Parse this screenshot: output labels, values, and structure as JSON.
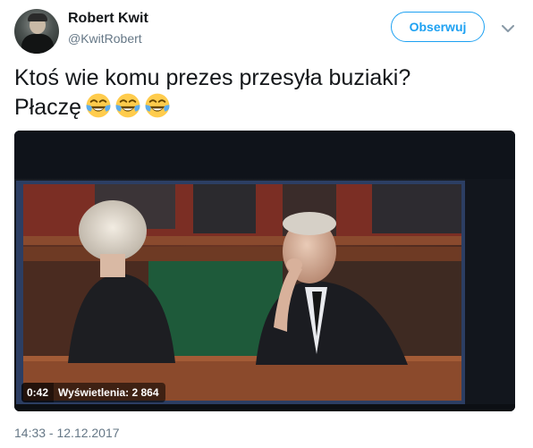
{
  "author": {
    "display_name": "Robert Kwit",
    "handle": "@KwitRobert",
    "avatar_icon": "user-avatar"
  },
  "actions": {
    "follow_label": "Obserwuj",
    "more_icon": "chevron-down-icon"
  },
  "tweet": {
    "line1": "Ktoś wie komu prezes przesyła buziaki?",
    "line2": "Płaczę",
    "emoji": [
      "face-with-tears-of-joy",
      "face-with-tears-of-joy",
      "face-with-tears-of-joy"
    ]
  },
  "video": {
    "duration": "0:42",
    "views_label": "Wyświetlenia: 2 864"
  },
  "meta": {
    "timestamp": "14:33 - 12.12.2017"
  },
  "colors": {
    "accent": "#1da1f2",
    "text_primary": "#14171a",
    "text_secondary": "#657786"
  }
}
